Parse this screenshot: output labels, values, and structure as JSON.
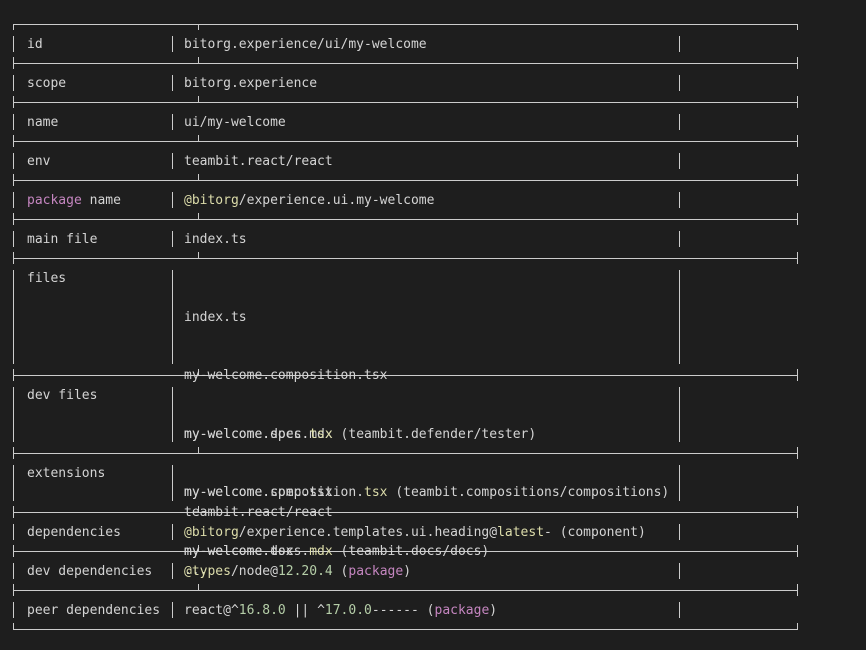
{
  "colors": {
    "background": "#1e1e1e",
    "text": "#d4d4d4",
    "border": "#cccccc",
    "scope_highlight": "#c586c0",
    "accent_yellow": "#dcdcaa",
    "accent_green": "#b5cea8"
  },
  "rows": [
    {
      "key": "id",
      "values": [
        "bitorg.experience/ui/my-welcome"
      ]
    },
    {
      "key": "scope",
      "values": [
        "bitorg.experience"
      ]
    },
    {
      "key": "name",
      "values": [
        "ui/my-welcome"
      ]
    },
    {
      "key": "env",
      "values": [
        "teambit.react/react"
      ]
    },
    {
      "key_prefix": "package",
      "key_suffix": " name",
      "value_parts": [
        "@",
        "bitorg",
        "/experience.ui.my-welcome"
      ]
    },
    {
      "key": "main file",
      "values": [
        "index.ts"
      ]
    },
    {
      "key": "files",
      "values": [
        "index.ts",
        "my-welcome.composition.tsx",
        "my-welcome.docs.mdx",
        "my-welcome.spec.tsx",
        "my-welcome.tsx"
      ]
    },
    {
      "key": "dev files",
      "dev_files": [
        {
          "name": "my-welcome.spec.",
          "ext": "tsx",
          "rest": " (teambit.defender/tester)"
        },
        {
          "name": "my-welcome.composition.",
          "ext": "tsx",
          "rest": " (teambit.compositions/compositions)"
        },
        {
          "name": "my-welcome.docs.",
          "ext": "mdx",
          "rest": " (teambit.docs/docs)"
        }
      ]
    },
    {
      "key": "extensions",
      "values": [
        "teambit.react/react",
        "..."
      ]
    },
    {
      "key": "dependencies",
      "dep": {
        "at": "@",
        "scope": "bitorg",
        "path": "/experience.templates.ui.heading@",
        "version": "latest",
        "rest": "- (component)"
      }
    },
    {
      "key": "dev dependencies",
      "devdep": {
        "at": "@",
        "scope": "types",
        "path": "/node@",
        "version": "12.20.4",
        "open": " (",
        "type": "package",
        "close": ")"
      }
    },
    {
      "key": "peer dependencies",
      "peerdep": {
        "name": "react@^",
        "v1": "16.8.0",
        "mid": " || ^",
        "v2": "17.0.0",
        "dashes": "------",
        "open": " (",
        "type": "package",
        "close": ")"
      }
    }
  ]
}
